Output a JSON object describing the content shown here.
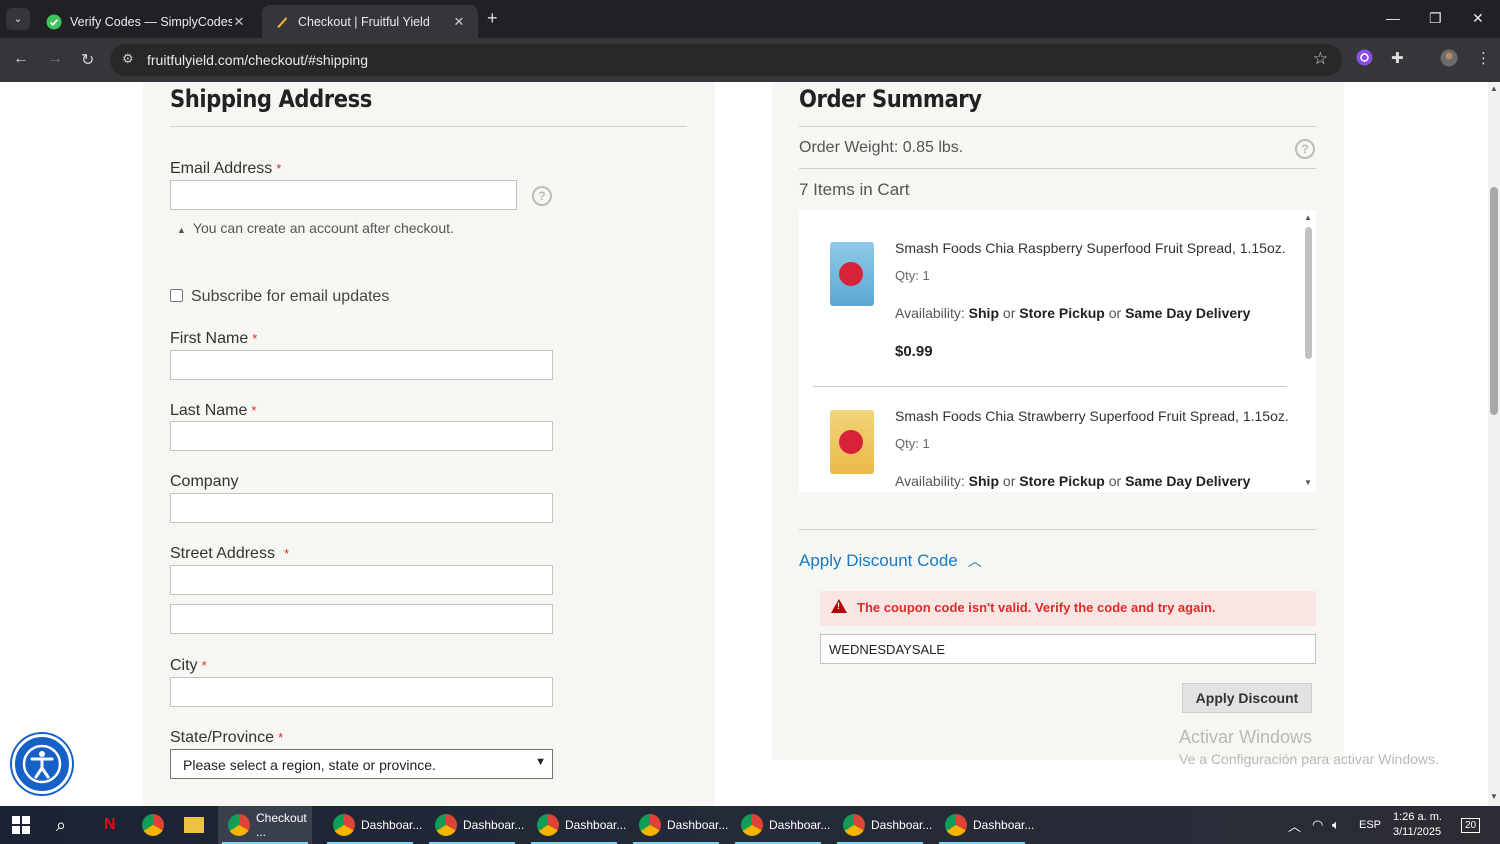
{
  "browser": {
    "tabs": [
      {
        "title": "Verify Codes — SimplyCodes",
        "icon": "simplycodes-icon",
        "active": false
      },
      {
        "title": "Checkout | Fruitful Yield",
        "icon": "fruitful-yield-icon",
        "active": true
      }
    ],
    "url": "fruitfulyield.com/checkout/#shipping"
  },
  "shipping": {
    "title": "Shipping Address",
    "email_label": "Email Address",
    "email_note": "You can create an account after checkout.",
    "subscribe_label": "Subscribe for email updates",
    "first_name_label": "First Name",
    "last_name_label": "Last Name",
    "company_label": "Company",
    "street_label": "Street Address",
    "city_label": "City",
    "state_label": "State/Province",
    "state_placeholder": "Please select a region, state or province.",
    "required_mark": "*"
  },
  "summary": {
    "title": "Order Summary",
    "weight": "Order Weight: 0.85 lbs.",
    "items_count": "7 Items in Cart",
    "items": [
      {
        "name": "Smash Foods Chia Raspberry Superfood Fruit Spread, 1.15oz.",
        "qty": "Qty: 1",
        "availability_prefix": "Availability:",
        "ship": "Ship",
        "or1": "or",
        "pickup": "Store Pickup",
        "or2": "or",
        "sameday": "Same Day Delivery",
        "price": "$0.99"
      },
      {
        "name": "Smash Foods Chia Strawberry Superfood Fruit Spread, 1.15oz.",
        "qty": "Qty: 1",
        "availability_prefix": "Availability:",
        "ship": "Ship",
        "or1": "or",
        "pickup": "Store Pickup",
        "or2": "or",
        "sameday": "Same Day Delivery"
      }
    ],
    "discount_toggle": "Apply Discount Code",
    "error": "The coupon code isn't valid. Verify the code and try again.",
    "code_value": "WEDNESDAYSALE",
    "apply_button": "Apply Discount"
  },
  "watermark": {
    "line1": "Activar Windows",
    "line2": "Ve a Configuración para activar Windows."
  },
  "taskbar": {
    "apps": [
      {
        "label": "Checkout ...",
        "active": true
      },
      {
        "label": "Dashboar...",
        "active": false
      },
      {
        "label": "Dashboar...",
        "active": false
      },
      {
        "label": "Dashboar...",
        "active": false
      },
      {
        "label": "Dashboar...",
        "active": false
      },
      {
        "label": "Dashboar...",
        "active": false
      },
      {
        "label": "Dashboar...",
        "active": false
      },
      {
        "label": "Dashboar...",
        "active": false
      }
    ],
    "lang": "ESP",
    "time": "1:26 a. m.",
    "date": "3/11/2025",
    "notifications": "20"
  },
  "colors": {
    "link": "#1979c3",
    "error": "#e02b27",
    "accessibility": "#1660c6"
  }
}
